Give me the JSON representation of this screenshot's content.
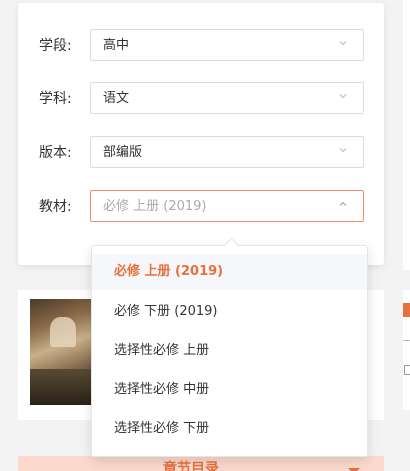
{
  "filters": [
    {
      "label": "学段:",
      "value": "高中"
    },
    {
      "label": "学科:",
      "value": "语文"
    },
    {
      "label": "版本:",
      "value": "部编版"
    },
    {
      "label": "教材:",
      "value": "必修 上册 (2019)"
    }
  ],
  "dropdown": {
    "options": [
      {
        "label": "必修 上册 (2019)",
        "selected": true
      },
      {
        "label": "必修 下册 (2019)",
        "selected": false
      },
      {
        "label": "选择性必修 上册",
        "selected": false
      },
      {
        "label": "选择性必修 中册",
        "selected": false
      },
      {
        "label": "选择性必修 下册",
        "selected": false
      }
    ]
  },
  "bottom_bar": {
    "label": "章节目录"
  },
  "colors": {
    "accent": "#e8703f",
    "active_bg": "#f5f7fa",
    "bottom_bg": "#fbd9cd"
  },
  "icons": {
    "collapsed": "chevron-down-icon",
    "expanded": "chevron-up-icon",
    "expand": "triangle-down-icon"
  }
}
